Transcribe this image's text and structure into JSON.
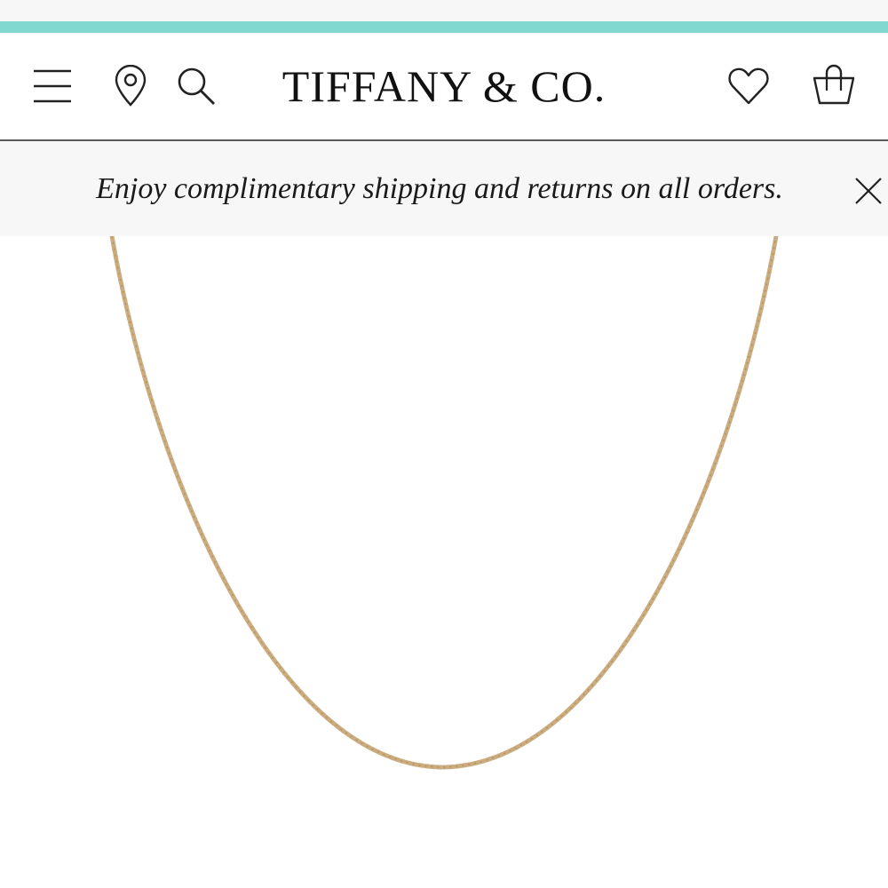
{
  "header": {
    "logo_text": "TIFFANY & CO.",
    "icons": {
      "menu": "hamburger-menu-icon",
      "location": "location-pin-icon",
      "search": "search-icon",
      "wishlist": "heart-icon",
      "bag": "shopping-bag-icon"
    }
  },
  "promo": {
    "text": "Enjoy complimentary shipping and returns on all orders.",
    "close_icon": "close-icon"
  },
  "colors": {
    "brand_blue": "#81d8d0",
    "promo_background": "#f7f7f7",
    "chain_gold": "#c8a878"
  },
  "product": {
    "image": "gold chain necklace"
  }
}
